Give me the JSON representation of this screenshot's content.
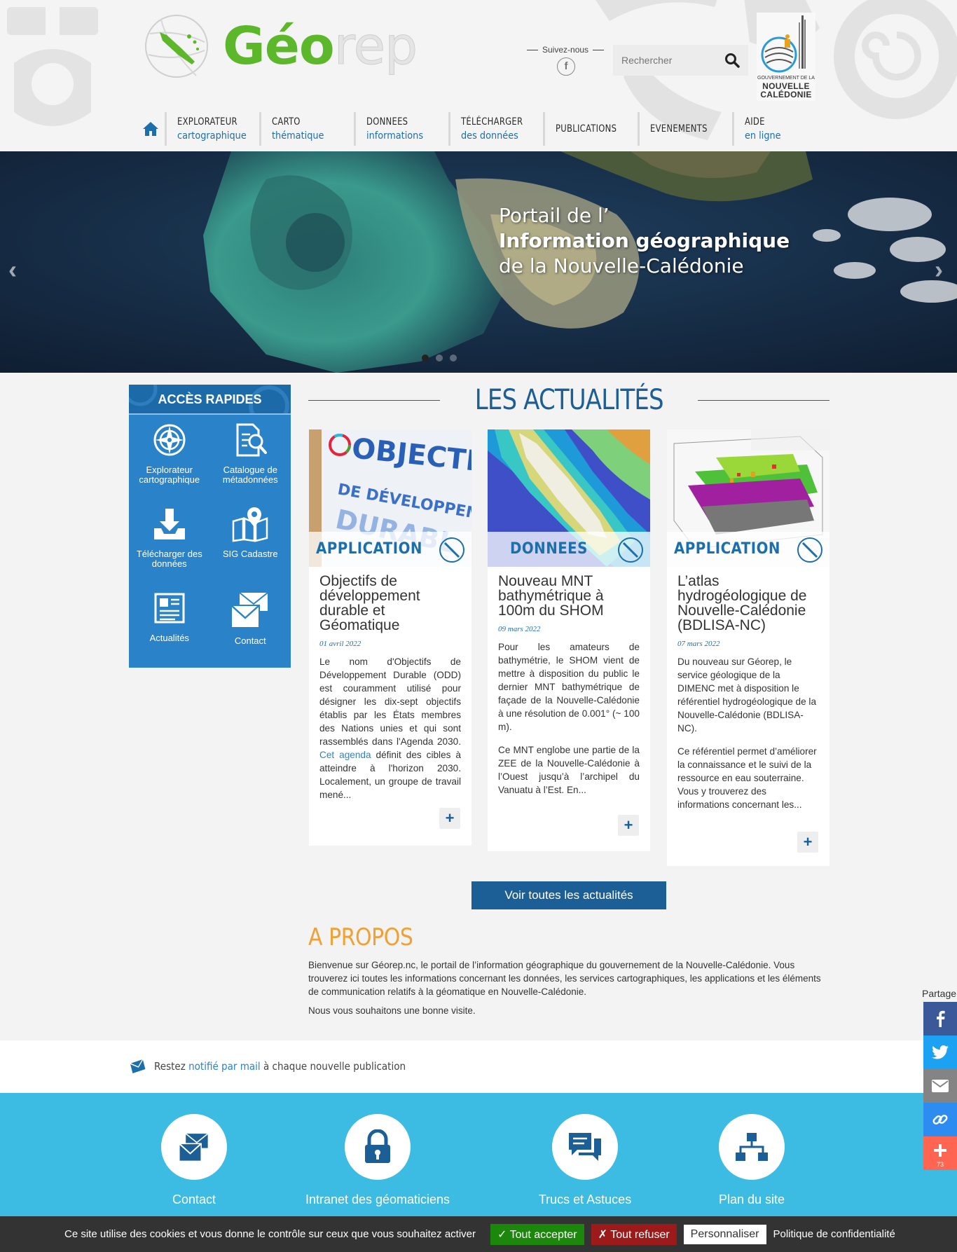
{
  "header": {
    "logo_geo": "Géo",
    "logo_rep": "rep",
    "follow_label": "Suivez-nous",
    "facebook_glyph": "f",
    "search_placeholder": "Rechercher",
    "gov_line1": "GOUVERNEMENT DE LA",
    "gov_line2": "NOUVELLE",
    "gov_line3": "CALÉDONIE"
  },
  "nav": {
    "items": [
      {
        "l1": "EXPLORATEUR",
        "l2": "cartographique"
      },
      {
        "l1": "CARTO",
        "l2": "thématique"
      },
      {
        "l1": "DONNEES",
        "l2": "informations"
      },
      {
        "l1": "TÉLÉCHARGER",
        "l2": "des données"
      },
      {
        "l1": "PUBLICATIONS",
        "l2": ""
      },
      {
        "l1": "EVENEMENTS",
        "l2": ""
      },
      {
        "l1": "AIDE",
        "l2": "en ligne"
      }
    ]
  },
  "hero": {
    "line1": "Portail de l’",
    "line2": "Information géographique",
    "line3": "de la Nouvelle-Calédonie",
    "prev": "‹",
    "next": "›"
  },
  "quick": {
    "title": "ACCÈS RAPIDES",
    "items": [
      {
        "label": "Explorateur cartographique",
        "icon": "compass-icon"
      },
      {
        "label": "Catalogue de métadonnées",
        "icon": "document-search-icon"
      },
      {
        "label": "Télécharger des données",
        "icon": "download-tray-icon"
      },
      {
        "label": "SIG Cadastre",
        "icon": "map-pin-icon"
      },
      {
        "label": "Actualités",
        "icon": "newspaper-icon"
      },
      {
        "label": "Contact",
        "icon": "envelope-icon"
      }
    ]
  },
  "news": {
    "title": "LES ACTUALITÉS",
    "cards": [
      {
        "tag": "APPLICATION",
        "img_text": "OBJECTIFS",
        "img_text2": "DE DÉVELOPPEMENT",
        "img_text3": "DURABL",
        "title": "Objectifs de développement durable et Géomatique",
        "date": "01 avril 2022",
        "p1_a": "Le nom d'Objectifs de Développement Durable (ODD) est couramment utilisé pour désigner les dix-sept objectifs établis par les États membres des Nations unies et qui sont rassemblés dans l'Agenda 2030. ",
        "p1_link": "Cet agenda",
        "p1_b": " définit des cibles à atteindre à l'horizon 2030. Localement, un groupe de travail mené...",
        "more": "+"
      },
      {
        "tag": "DONNEES",
        "title": "Nouveau MNT bathymétrique à 100m du SHOM",
        "date": "09 mars 2022",
        "p1": "Pour les amateurs de bathymétrie, le SHOM vient de mettre à disposition du public le dernier MNT bathymétrique de façade de la Nouvelle-Calédonie à une résolution de 0.001° (~ 100 m).",
        "p2": "Ce MNT englobe une partie de la ZEE de la Nouvelle-Calédonie à l’Ouest jusqu’à l’archipel du Vanuatu à l’Est. En...",
        "more": "+"
      },
      {
        "tag": "APPLICATION",
        "title": "L’atlas hydrogéologique de Nouvelle-Calédonie (BDLISA-NC)",
        "date": "07 mars 2022",
        "p1": "Du nouveau sur Géorep, le service géologique de la DIMENC met à disposition le référentiel hydrogéologique de la Nouvelle-Calédonie (BDLISA-NC).",
        "p2": "Ce référentiel permet d’améliorer la connaissance et le suivi de la ressource en eau souterraine. Vous y trouverez des informations concernant les...",
        "more": "+"
      }
    ],
    "all_button": "Voir toutes les actualités"
  },
  "apropos": {
    "title": "A PROPOS",
    "p1": "Bienvenue sur Géorep.nc, le portail de l’information géographique du gouvernement de la Nouvelle-Calédonie. Vous trouverez ici toutes les informations concernant les données, les services cartographiques, les applications et les éléments de communication relatifs à la géomatique en Nouvelle-Calédonie.",
    "p2": "Nous vous souhaitons une bonne visite."
  },
  "notify": {
    "before": "Restez ",
    "link": "notifié par mail",
    "after": " à chaque nouvelle publication"
  },
  "footer": {
    "items": [
      {
        "label": "Contact",
        "icon": "envelope-icon"
      },
      {
        "label": "Intranet des géomaticiens",
        "icon": "lock-icon"
      },
      {
        "label": "Trucs et Astuces",
        "icon": "chat-bubbles-icon"
      },
      {
        "label": "Plan du site",
        "icon": "sitemap-icon"
      }
    ]
  },
  "cookie": {
    "text": "Ce site utilise des cookies et vous donne le contrôle sur ceux que vous souhaitez activer",
    "accept": "✓ Tout accepter",
    "refuse": "✗ Tout refuser",
    "customize": "Personnaliser",
    "policy": "Politique de confidentialité"
  },
  "share": {
    "label": "Partage",
    "count": "73"
  },
  "colors": {
    "brand_green": "#5cb82a",
    "brand_blue": "#1c5f96",
    "accent_orange": "#f0a135",
    "footer_cyan": "#3cbbe3",
    "facebook": "#3b5998",
    "twitter": "#1da1f2",
    "email_gray": "#848484",
    "copy_blue": "#2d8cf0",
    "more_red": "#ff6550"
  }
}
